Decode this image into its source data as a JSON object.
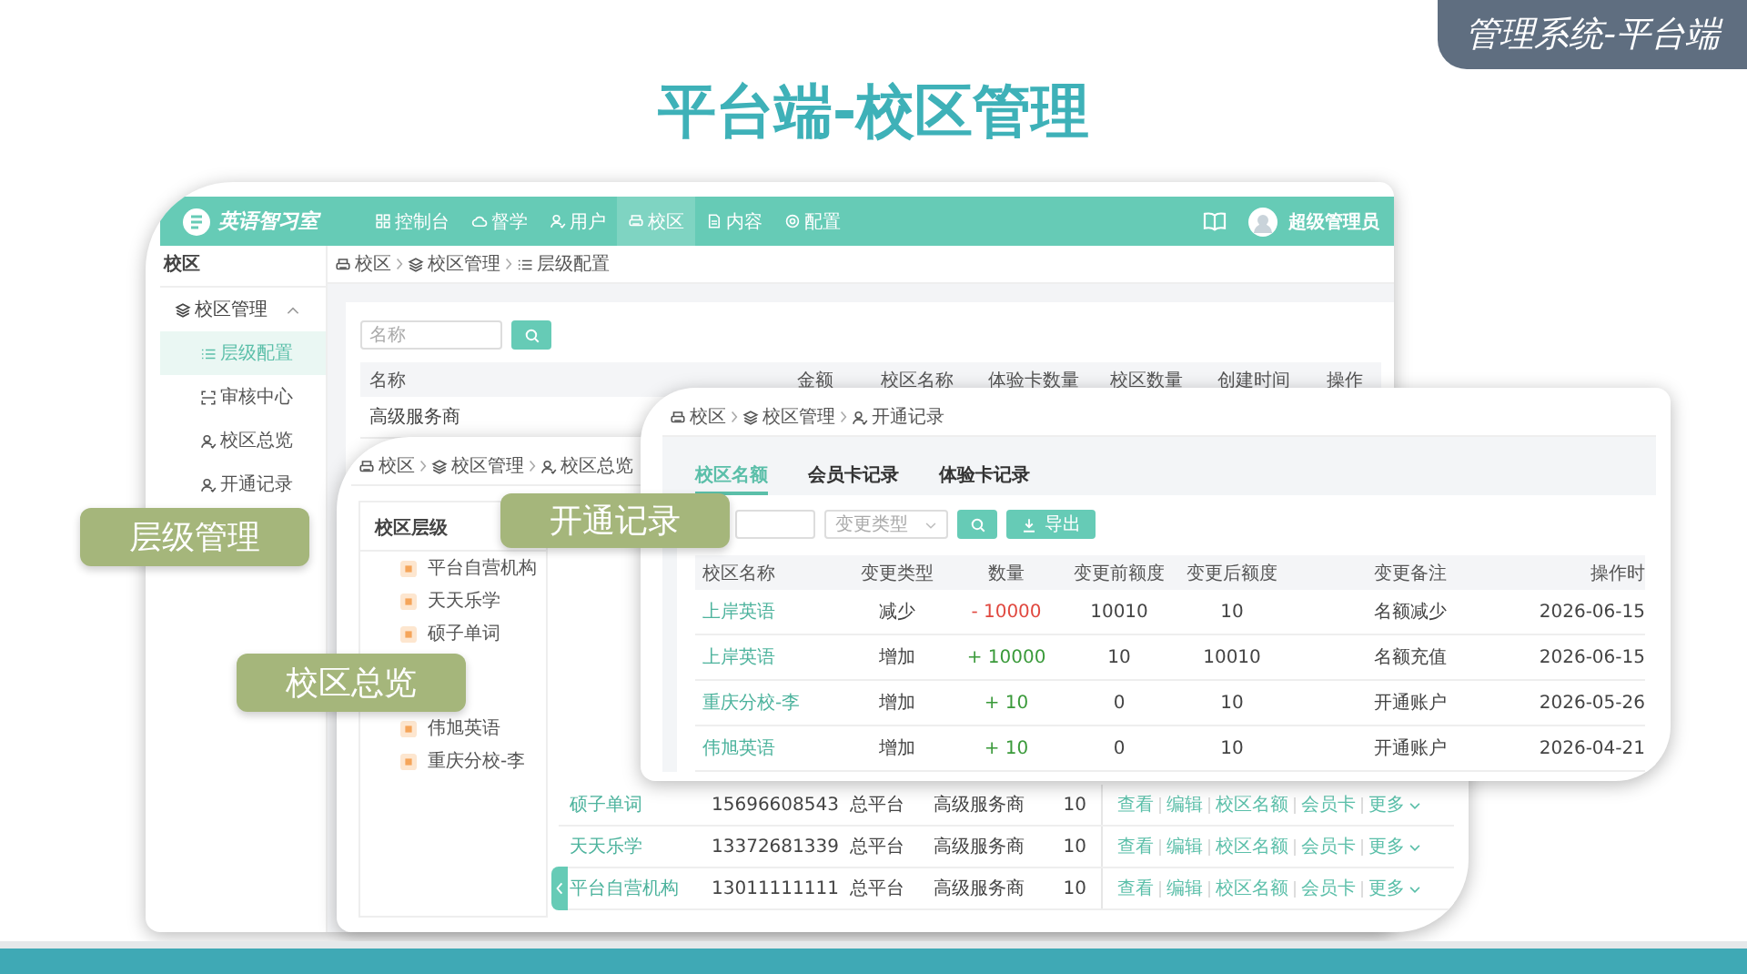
{
  "badge": {
    "text": "管理系统-平台端"
  },
  "title": "平台端-校区管理",
  "back_window": {
    "logo": {
      "name": "英语智习室"
    },
    "nav": [
      {
        "label": "控制台",
        "selected": false
      },
      {
        "label": "督学",
        "selected": false
      },
      {
        "label": "用户",
        "selected": false
      },
      {
        "label": "校区",
        "selected": true
      },
      {
        "label": "内容",
        "selected": false
      },
      {
        "label": "配置",
        "selected": false
      }
    ],
    "user": {
      "name": "超级管理员"
    },
    "sidebar": {
      "title": "校区",
      "group": {
        "label": "校区管理",
        "expanded": true,
        "items": [
          {
            "label": "层级配置",
            "selected": true
          },
          {
            "label": "审核中心",
            "selected": false
          },
          {
            "label": "校区总览",
            "selected": false
          },
          {
            "label": "开通记录",
            "selected": false
          }
        ]
      }
    },
    "breadcrumb": [
      "校区",
      "校区管理",
      "层级配置"
    ],
    "search": {
      "placeholder": "名称"
    },
    "table": {
      "columns": [
        "名称",
        "金额",
        "校区名称",
        "体验卡数量",
        "校区数量",
        "创建时间",
        "操作"
      ],
      "rows": [
        [
          "高级服务商"
        ]
      ]
    }
  },
  "middle_window": {
    "breadcrumb": [
      "校区",
      "校区管理",
      "校区总览"
    ],
    "tree": {
      "title": "校区层级",
      "items": [
        "平台自营机构",
        "天天乐学",
        "硕子单词",
        "伟旭英语",
        "重庆分校-李"
      ]
    },
    "rows": [
      {
        "name": "硕子单词",
        "phone": "15696608543",
        "platform": "总平台",
        "level": "高级服务商",
        "count": "10",
        "actions": [
          "查看",
          "编辑",
          "校区名额",
          "会员卡"
        ],
        "more": "更多"
      },
      {
        "name": "天天乐学",
        "phone": "13372681339",
        "platform": "总平台",
        "level": "高级服务商",
        "count": "10",
        "actions": [
          "查看",
          "编辑",
          "校区名额",
          "会员卡"
        ],
        "more": "更多"
      },
      {
        "name": "平台自营机构",
        "phone": "13011111111",
        "platform": "总平台",
        "level": "高级服务商",
        "count": "10",
        "actions": [
          "查看",
          "编辑",
          "校区名额",
          "会员卡"
        ],
        "more": "更多"
      }
    ]
  },
  "front_window": {
    "breadcrumb": [
      "校区",
      "校区管理",
      "开通记录"
    ],
    "tabs": [
      {
        "label": "校区名额",
        "selected": true
      },
      {
        "label": "会员卡记录",
        "selected": false
      },
      {
        "label": "体验卡记录",
        "selected": false
      }
    ],
    "filter": {
      "select_placeholder": "变更类型",
      "export": "导出"
    },
    "columns": [
      "校区名称",
      "变更类型",
      "数量",
      "变更前额度",
      "变更后额度",
      "变更备注",
      "操作时"
    ],
    "rows": [
      {
        "campus": "上岸英语",
        "type": "减少",
        "amount": "- 10000",
        "color": "#e0483f",
        "before": "10010",
        "after": "10",
        "note": "名额减少",
        "time": "2026-06-15"
      },
      {
        "campus": "上岸英语",
        "type": "增加",
        "amount": "+ 10000",
        "color": "#3a9a3a",
        "before": "10",
        "after": "10010",
        "note": "名额充值",
        "time": "2026-06-15"
      },
      {
        "campus": "重庆分校-李",
        "type": "增加",
        "amount": "+ 10",
        "color": "#3a9a3a",
        "before": "0",
        "after": "10",
        "note": "开通账户",
        "time": "2026-05-26"
      },
      {
        "campus": "伟旭英语",
        "type": "增加",
        "amount": "+ 10",
        "color": "#3a9a3a",
        "before": "0",
        "after": "10",
        "note": "开通账户",
        "time": "2026-04-21"
      }
    ]
  },
  "callouts": [
    "层级管理",
    "开通记录",
    "校区总览"
  ]
}
